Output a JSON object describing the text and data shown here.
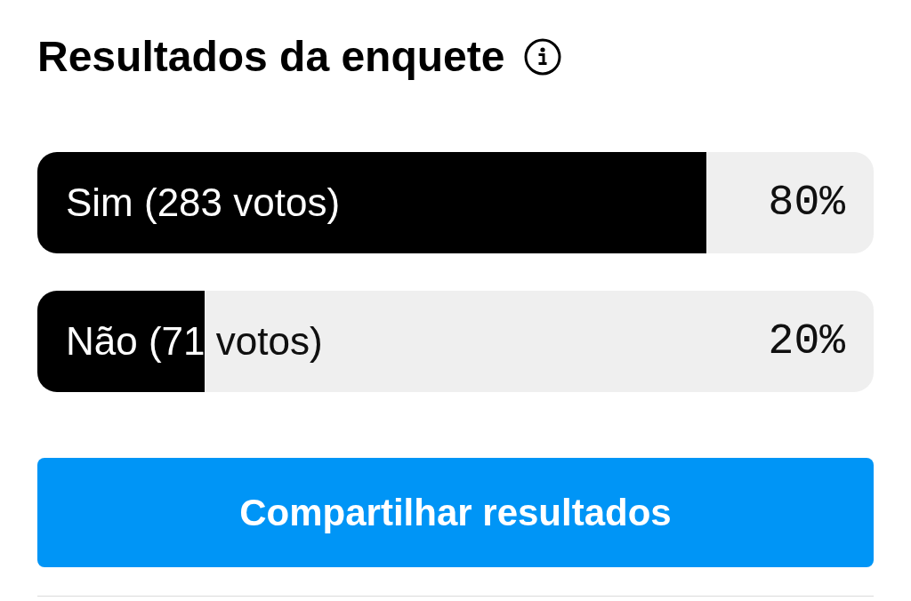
{
  "title": "Resultados da enquete",
  "options": [
    {
      "label": "Sim (283 votos)",
      "level": 0.8,
      "percent": "80%"
    },
    {
      "label": "Não (71 votos)",
      "level": 0.2,
      "percent": "20%"
    }
  ],
  "share_button": "Compartilhar resultados"
}
